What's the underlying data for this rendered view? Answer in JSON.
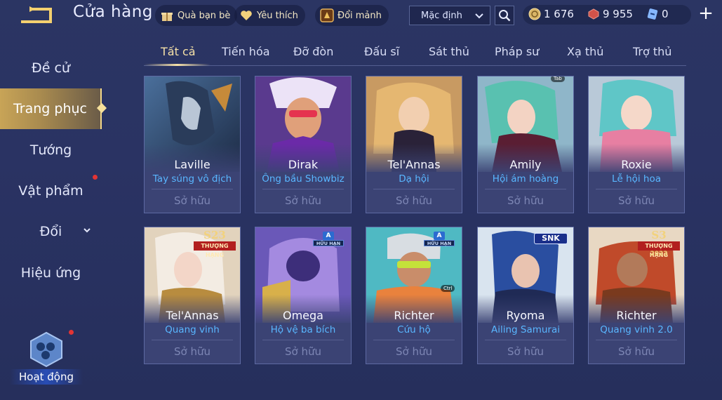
{
  "header": {
    "title": "Cửa hàng",
    "gift_label": "Quà bạn bè",
    "favorite_label": "Yêu thích",
    "exchange_label": "Đổi mảnh",
    "sort_value": "Mặc định",
    "currency": {
      "coins": "1 676",
      "vouchers": "9 955",
      "tokens": "0"
    }
  },
  "sidebar": {
    "items": [
      {
        "label": "Đề cử"
      },
      {
        "label": "Trang phục"
      },
      {
        "label": "Tướng"
      },
      {
        "label": "Vật phẩm"
      },
      {
        "label": "Đổi"
      },
      {
        "label": "Hiệu ứng"
      }
    ],
    "activity_label": "Hoạt động"
  },
  "tabs": [
    "Tất cả",
    "Tiến hóa",
    "Đỡ đòn",
    "Đấu sĩ",
    "Sát thủ",
    "Pháp sư",
    "Xạ thủ",
    "Trợ thủ"
  ],
  "cards": [
    {
      "hero": "Laville",
      "skin": "Tay súng vô địch",
      "status": "Sở hữu",
      "badge": ""
    },
    {
      "hero": "Dirak",
      "skin": "Ông bầu Showbiz",
      "status": "Sở hữu",
      "badge": ""
    },
    {
      "hero": "Tel'Annas",
      "skin": "Dạ hội",
      "status": "Sở hữu",
      "badge": ""
    },
    {
      "hero": "Amily",
      "skin": "Hội ám hoàng",
      "status": "Sở hữu",
      "badge": ""
    },
    {
      "hero": "Roxie",
      "skin": "Lễ hội hoa",
      "status": "Sở hữu",
      "badge": ""
    },
    {
      "hero": "Tel'Annas",
      "skin": "Quang vinh",
      "status": "Sở hữu",
      "badge_num": "S23",
      "badge_label": "THƯỢNG HẠNG"
    },
    {
      "hero": "Omega",
      "skin": "Hộ vệ ba bích",
      "status": "Sở hữu",
      "badge_letter": "A",
      "badge_label": "HỮU HẠN"
    },
    {
      "hero": "Richter",
      "skin": "Cứu hộ",
      "status": "Sở hữu",
      "badge_letter": "A",
      "badge_label": "HỮU HẠN"
    },
    {
      "hero": "Ryoma",
      "skin": "Ailing Samurai",
      "status": "Sở hữu",
      "badge_label": "SNK"
    },
    {
      "hero": "Richter",
      "skin": "Quang vinh 2.0",
      "status": "Sở hữu",
      "badge_num": "S3",
      "badge_label": "THƯỢNG HẠNG",
      "badge_year": "2023"
    }
  ],
  "overlays": {
    "tab_hint": "Tab",
    "ctrl_hint": "Ctrl"
  },
  "colors": {
    "accent_gold": "#f6e1a8",
    "skin_name_blue": "#59b6ff",
    "badge_red": "#b21f1f"
  }
}
